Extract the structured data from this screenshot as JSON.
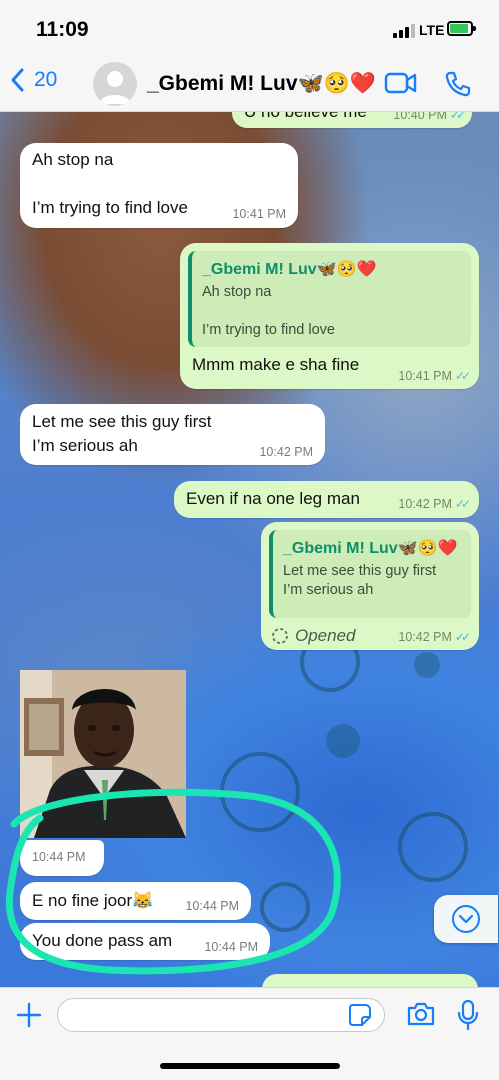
{
  "status": {
    "time": "11:09",
    "network": "LTE"
  },
  "header": {
    "back_count": "20",
    "contact": "_Gbemi M! Luv🦋🥺❤️"
  },
  "messages": {
    "top_partial": {
      "text": "U no believe me",
      "time": "10:40 PM"
    },
    "m1": {
      "line1": "Ah stop na",
      "line2": "I’m trying to find love",
      "time": "10:41 PM"
    },
    "m2": {
      "quote_name": "_Gbemi M! Luv🦋🥺❤️",
      "quote_line1": "Ah stop na",
      "quote_line2": "I’m trying to find love",
      "text": "Mmm make e sha fine",
      "time": "10:41 PM"
    },
    "m3": {
      "line1": "Let me see this guy first",
      "line2": "I’m serious ah",
      "time": "10:42 PM"
    },
    "m4": {
      "text": "Even if na one leg man",
      "time": "10:42 PM"
    },
    "m5": {
      "quote_name": "_Gbemi M! Luv🦋🥺❤️",
      "quote_line1": "Let me see this guy first",
      "quote_line2": "I’m serious ah",
      "text": "Opened",
      "time": "10:42 PM"
    },
    "m6": {
      "time": "10:44 PM"
    },
    "m7": {
      "text": "E no fine joor😹",
      "time": "10:44 PM"
    },
    "m8": {
      "text": "You done pass am",
      "time": "10:44 PM"
    }
  },
  "colors": {
    "accent": "#157efb",
    "outgoing": "#dcf8c6",
    "incoming": "#ffffff",
    "ticks": "#4fb6ec",
    "annotation": "#19e6b0"
  }
}
